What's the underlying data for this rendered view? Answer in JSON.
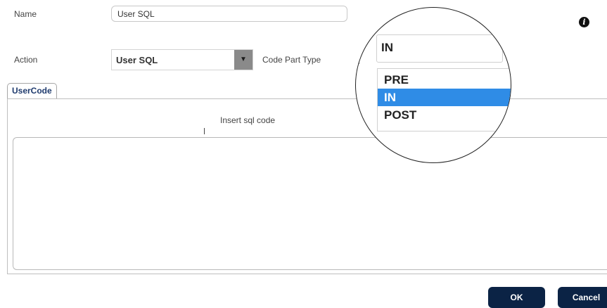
{
  "form": {
    "name_label": "Name",
    "name_value": "User SQL",
    "action_label": "Action",
    "action_value": "User SQL",
    "code_part_type_label": "Code Part Type",
    "info_icon": "info-icon"
  },
  "tabs": [
    {
      "label": "UserCode",
      "active": true
    }
  ],
  "editor": {
    "instruction": "Insert sql code",
    "value": ""
  },
  "code_part_dropdown": {
    "selected": "IN",
    "options": [
      "PRE",
      "IN",
      "POST"
    ],
    "highlighted": "IN",
    "highlight_color": "#2f8ce6"
  },
  "buttons": {
    "ok_label": "OK",
    "cancel_label": "Cancel",
    "color": "#0b2345"
  }
}
